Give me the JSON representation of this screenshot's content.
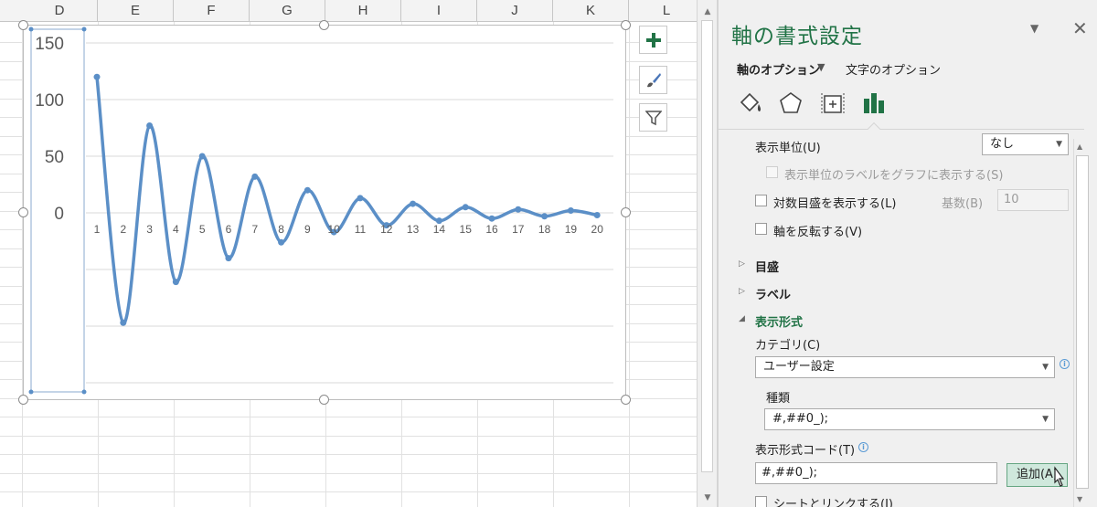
{
  "spreadsheet": {
    "columns": [
      "D",
      "E",
      "F",
      "G",
      "H",
      "I",
      "J",
      "K",
      "L"
    ]
  },
  "chart_data": {
    "type": "line",
    "title": "",
    "x": [
      1,
      2,
      3,
      4,
      5,
      6,
      7,
      8,
      9,
      10,
      11,
      12,
      13,
      14,
      15,
      16,
      17,
      18,
      19,
      20
    ],
    "series": [
      {
        "values": [
          120,
          -97,
          77,
          -61,
          50,
          -40,
          32,
          -26,
          20,
          -17,
          13,
          -11,
          8,
          -7,
          5,
          -5,
          3,
          -3,
          2,
          -2
        ]
      }
    ],
    "y_tick_labels": [
      "150",
      "100",
      "50",
      "0"
    ],
    "ylim": [
      -150,
      150
    ],
    "grid": true,
    "color": "#5b8fc7"
  },
  "format_pane": {
    "title": "軸の書式設定",
    "tab_axis_options": "軸のオプション",
    "tab_text_options": "文字のオプション",
    "display_units_label": "表示単位(U)",
    "display_units_value": "なし",
    "show_units_label": "表示単位のラベルをグラフに表示する(S)",
    "log_scale_label": "対数目盛を表示する(L)",
    "base_label": "基数(B)",
    "base_value": "10",
    "reverse_label": "軸を反転する(V)",
    "section_ticks": "目盛",
    "section_labels": "ラベル",
    "section_number": "表示形式",
    "category_label": "カテゴリ(C)",
    "category_value": "ユーザー設定",
    "type_label": "種類",
    "type_value": "#,##0_);",
    "format_code_label": "表示形式コード(T)",
    "format_code_value": "#,##0_);",
    "add_button": "追加(A)",
    "link_to_sheet_label": "シートとリンクする(I)",
    "accent_color": "#217346"
  }
}
